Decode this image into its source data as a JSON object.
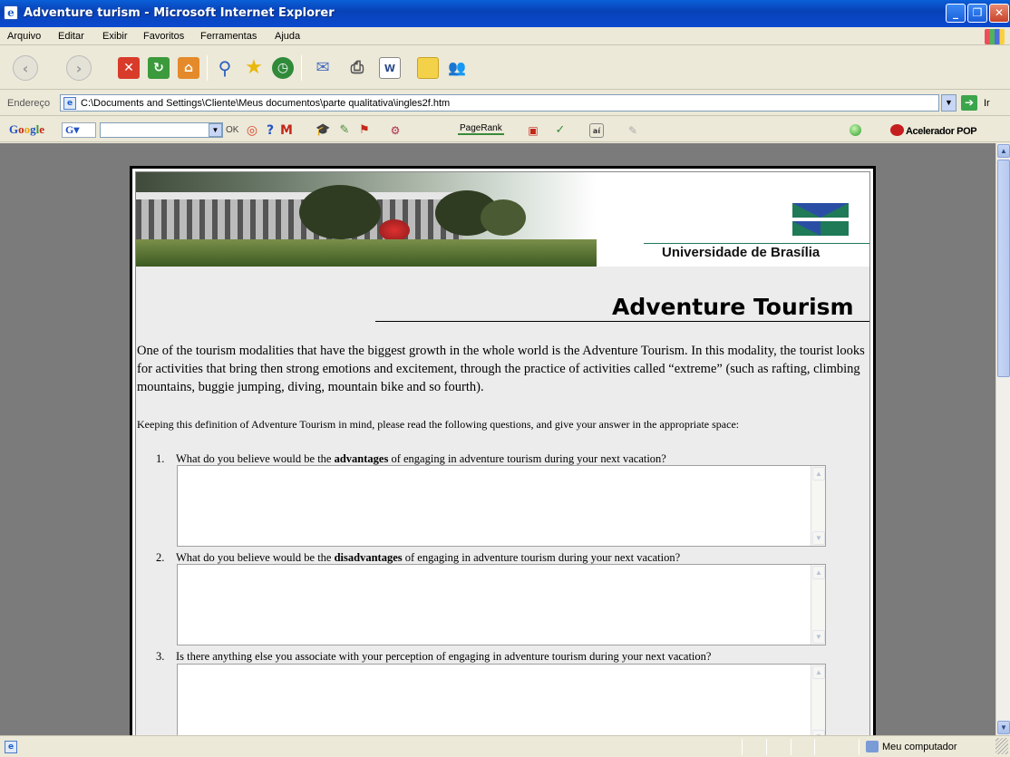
{
  "window": {
    "title": "Adventure turism - Microsoft Internet Explorer",
    "min_glyph": "_",
    "max_glyph": "❐",
    "close_glyph": "✕"
  },
  "menu": {
    "items": [
      "Arquivo",
      "Editar",
      "Exibir",
      "Favoritos",
      "Ferramentas",
      "Ajuda"
    ]
  },
  "address": {
    "label": "Endereço",
    "url": "C:\\Documents and Settings\\Cliente\\Meus documentos\\parte qualitativa\\ingles2f.htm",
    "go_label": "Ir"
  },
  "google_toolbar": {
    "logo": [
      "G",
      "o",
      "o",
      "g",
      "l",
      "e"
    ],
    "g_button": "G",
    "ok_label": "OK",
    "pagerank_label": "PageRank",
    "acelerador_label": "Acelerador POP"
  },
  "page": {
    "banner_caption": "Universidade de Brasília",
    "title": "Adventure Tourism",
    "intro": "One of the tourism modalities that have the biggest growth in the whole world is the Adventure Tourism. In this modality, the tourist looks for activities that bring then strong emotions and excitement, through the practice of activities called “extreme” (such as rafting, climbing mountains, buggie jumping, diving, mountain bike and so fourth).",
    "instruction": "Keeping this definition of Adventure Tourism in mind, please read the following questions, and give your answer in the appropriate space:",
    "questions": [
      {
        "num": "1.",
        "before": "What do you believe would be the ",
        "bold": "advantages",
        "after": " of engaging in adventure tourism during your next vacation?",
        "answer": ""
      },
      {
        "num": "2.",
        "before": "What do you believe would be the ",
        "bold": "disadvantages",
        "after": " of engaging in adventure tourism during your next vacation?",
        "answer": ""
      },
      {
        "num": "3.",
        "before": "Is there anything else you associate with your perception of engaging in adventure tourism during your next vacation?",
        "bold": "",
        "after": "",
        "answer": ""
      }
    ]
  },
  "status": {
    "zone": "Meu computador"
  },
  "icons": {
    "back": "back-arrow-icon",
    "forward": "forward-arrow-icon",
    "stop": "stop-icon",
    "refresh": "refresh-icon",
    "home": "home-icon",
    "search": "search-icon",
    "favorites": "favorites-star-icon",
    "history": "history-icon",
    "mail": "mail-icon",
    "print": "print-icon",
    "edit": "word-edit-icon",
    "folder": "folder-icon",
    "messenger": "messenger-icon"
  },
  "colors": {
    "titlebar": "#0842b7",
    "unb_green": "#1f7a58",
    "unb_blue": "#2b4ea5"
  }
}
